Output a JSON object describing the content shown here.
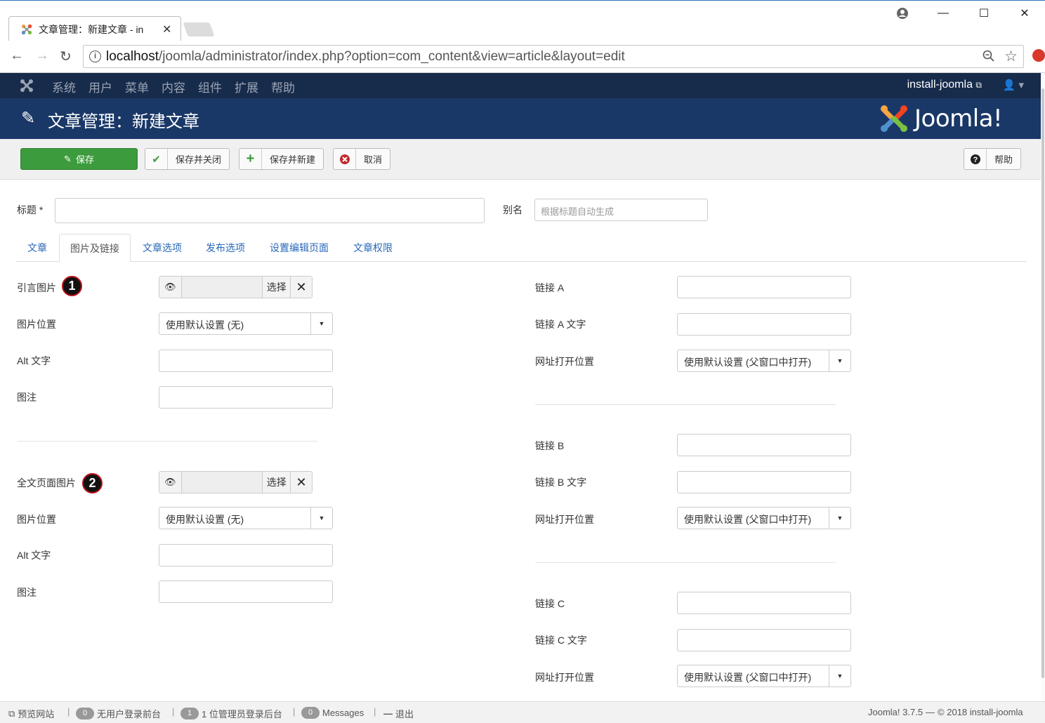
{
  "browser": {
    "tab_title": "文章管理：新建文章 - in",
    "url_host": "localhost",
    "url_path": "/joomla/administrator/index.php?option=com_content&view=article&layout=edit"
  },
  "topnav": {
    "items": [
      "系统",
      "用户",
      "菜单",
      "内容",
      "组件",
      "扩展",
      "帮助"
    ],
    "site_name": "install-joomla"
  },
  "header": {
    "page_title": "文章管理：新建文章",
    "brand": "Joomla!"
  },
  "toolbar": {
    "save": "保存",
    "save_close": "保存并关闭",
    "save_new": "保存并新建",
    "cancel": "取消",
    "help": "帮助"
  },
  "form": {
    "title_label": "标题 *",
    "alias_label": "别名",
    "alias_placeholder": "根据标题自动生成"
  },
  "tabs": [
    "文章",
    "图片及链接",
    "文章选项",
    "发布选项",
    "设置编辑页面",
    "文章权限"
  ],
  "images": {
    "intro_label": "引言图片",
    "full_label": "全文页面图片",
    "select": "选择",
    "badge_1": "1",
    "badge_2": "2",
    "float_label": "图片位置",
    "float_value": "使用默认设置 (无)",
    "alt_label": "Alt 文字",
    "caption_label": "图注"
  },
  "links": {
    "a_label": "链接 A",
    "a_text_label": "链接 A 文字",
    "b_label": "链接 B",
    "b_text_label": "链接 B 文字",
    "c_label": "链接 C",
    "c_text_label": "链接 C 文字",
    "target_label": "网址打开位置",
    "target_value": "使用默认设置 (父窗口中打开)"
  },
  "status": {
    "preview": "预览网站",
    "visitors_count": "0",
    "visitors_text": "无用户登录前台",
    "admins_count": "1",
    "admins_text": "1 位管理员登录后台",
    "messages_count": "0",
    "messages_text": "Messages",
    "logout": "退出",
    "version": "Joomla! 3.7.5",
    "copyright": "© 2018 install-joomla"
  },
  "colors": {
    "topnav": "#172b4b",
    "header": "#1a3867",
    "save_button": "#3c9b3c",
    "tab_link": "#2a69b8"
  }
}
